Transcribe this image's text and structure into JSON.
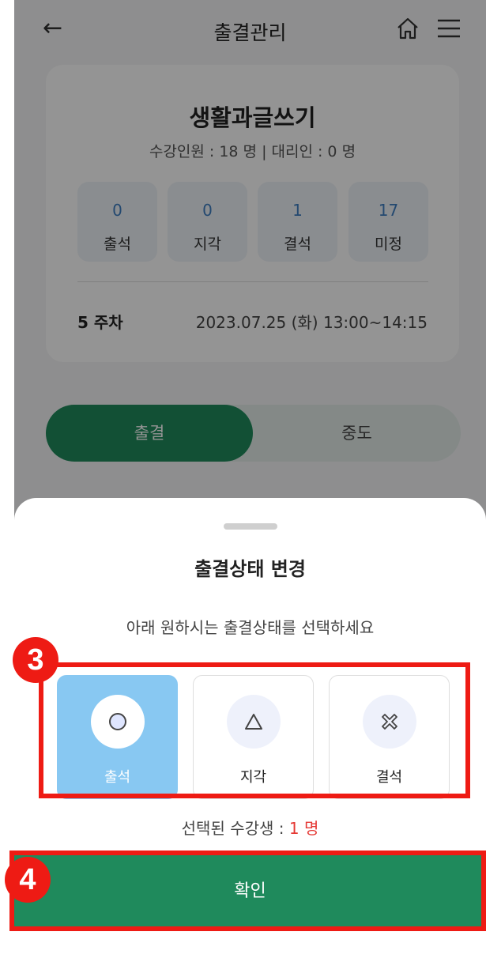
{
  "header": {
    "title": "출결관리",
    "back_icon": "←"
  },
  "course": {
    "name": "생활과글쓰기",
    "counts_text": "수강인원 : 18 명 | 대리인 : 0 명"
  },
  "stats": [
    {
      "value": "0",
      "label": "출석"
    },
    {
      "value": "0",
      "label": "지각"
    },
    {
      "value": "1",
      "label": "결석"
    },
    {
      "value": "17",
      "label": "미정"
    }
  ],
  "session": {
    "week": "5 주차",
    "datetime": "2023.07.25 (화) 13:00~14:15"
  },
  "segment": {
    "active": "출결",
    "other": "중도"
  },
  "sheet": {
    "title": "출결상태 변경",
    "subtitle": "아래 원하시는 출결상태를 선택하세요",
    "options": [
      {
        "label": "출석",
        "icon": "circle-icon",
        "selected": true
      },
      {
        "label": "지각",
        "icon": "triangle-icon",
        "selected": false
      },
      {
        "label": "결석",
        "icon": "x-icon",
        "selected": false
      }
    ],
    "selected_prefix": "선택된 수강생 : ",
    "selected_count": "1 명",
    "confirm": "확인"
  },
  "annotations": {
    "badge3": "3",
    "badge4": "4"
  },
  "colors": {
    "primary_green": "#1f8a5c",
    "selected_blue": "#88c8f2",
    "annotation_red": "#ee1b14",
    "stat_blue": "#3f7fc2"
  }
}
